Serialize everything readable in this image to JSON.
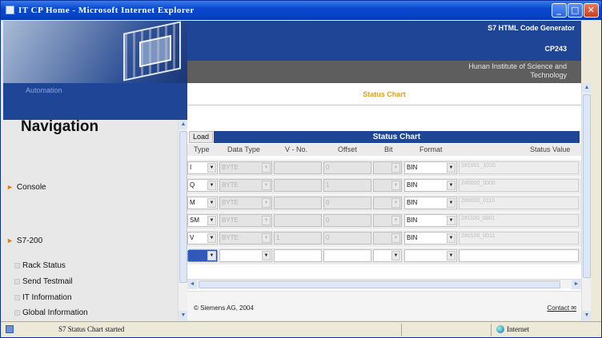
{
  "window": {
    "title": "IT CP Home - Microsoft Internet Explorer"
  },
  "left": {
    "automation": "Automation",
    "nav_title": "Navigation",
    "console": "Console",
    "s7_200": "S7-200",
    "sub_items": [
      "Rack Status",
      "Send Testmail",
      "IT Information",
      "Global Information"
    ]
  },
  "header": {
    "product": "S7 HTML Code Generator",
    "module": "CP243",
    "institute_line1": "Hunan Institute of Science and",
    "institute_line2": "Technology"
  },
  "content": {
    "page_title": "Status Chart",
    "load_label": "Load",
    "table_title": "Status Chart",
    "columns": [
      "Type",
      "Data Type",
      "V - No.",
      "Offset",
      "Bit",
      "Format",
      "Status Value"
    ],
    "rows": [
      {
        "type": "I",
        "dtype": "BYTE",
        "vno": "",
        "offset": "0",
        "format": "BIN",
        "status": "2#1001_1010"
      },
      {
        "type": "Q",
        "dtype": "BYTE",
        "vno": "",
        "offset": "1",
        "format": "BIN",
        "status": "2#0000_0000"
      },
      {
        "type": "M",
        "dtype": "BYTE",
        "vno": "",
        "offset": "0",
        "format": "BIN",
        "status": "2#0000_0110"
      },
      {
        "type": "SM",
        "dtype": "BYTE",
        "vno": "",
        "offset": "0",
        "format": "BIN",
        "status": "2#1100_0001"
      },
      {
        "type": "V",
        "dtype": "BYTE",
        "vno": "1",
        "offset": "0",
        "format": "BIN",
        "status": "2#0100_0011"
      },
      {
        "type": "",
        "dtype": "",
        "vno": "",
        "offset": "",
        "format": "",
        "status": ""
      }
    ],
    "copyright": "© Siemens AG, 2004",
    "contact": "Contact"
  },
  "statusbar": {
    "message": "S7 Status Chart started",
    "zone": "Internet"
  },
  "colors": {
    "titlebar": "#0a49d0",
    "header_blue": "#1e4596",
    "accent_orange": "#e0a020"
  }
}
